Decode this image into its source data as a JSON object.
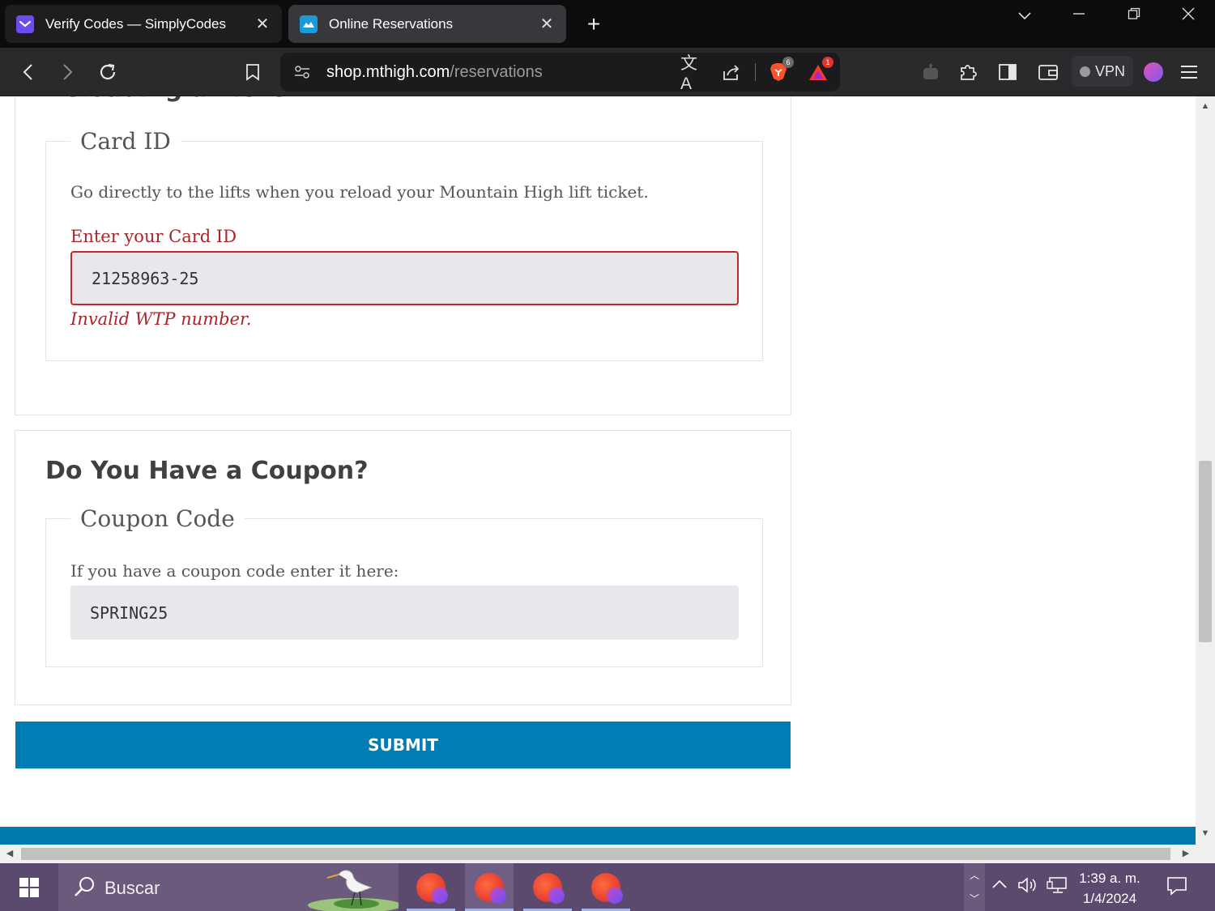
{
  "browser": {
    "tabs": [
      {
        "title": "Verify Codes — SimplyCodes",
        "active": false
      },
      {
        "title": "Online Reservations",
        "active": true
      }
    ],
    "url_host": "shop.mthigh.com",
    "url_path": "/reservations",
    "shield_badge": "6",
    "alert_badge": "1",
    "vpn_label": "VPN",
    "icons": {
      "tab_close": "close-icon",
      "new_tab": "plus-icon",
      "back": "chevron-left-icon",
      "forward": "chevron-right-icon",
      "reload": "reload-icon",
      "bookmark": "bookmark-icon",
      "site_info": "tune-icon",
      "translate": "translate-icon",
      "share": "share-icon",
      "brave_shields": "brave-lion-icon",
      "brave_rewards": "triangle-alert-icon",
      "leo": "robot-icon",
      "extensions": "puzzle-icon",
      "sidebar": "sidebar-icon",
      "wallet": "wallet-icon",
      "profile": "profile-avatar-icon",
      "menu": "hamburger-menu-icon"
    }
  },
  "page": {
    "reload_heading": "Reloading a Ticket?",
    "card_legend": "Card ID",
    "card_description": "Go directly to the lifts when you reload your Mountain High lift ticket.",
    "card_label": "Enter your Card ID",
    "card_value": "21258963-25",
    "card_error": "Invalid WTP number.",
    "coupon_heading": "Do You Have a Coupon?",
    "coupon_legend": "Coupon Code",
    "coupon_description": "If you have a coupon code enter it here:",
    "coupon_value": "SPRING25",
    "submit_label": "SUBMIT"
  },
  "taskbar": {
    "search_label": "Buscar",
    "time": "1:39 a. m.",
    "date": "1/4/2024"
  },
  "colors": {
    "accent_blue": "#007eb3",
    "error_red": "#a8262b",
    "taskbar_purple": "#5c4a6e"
  }
}
